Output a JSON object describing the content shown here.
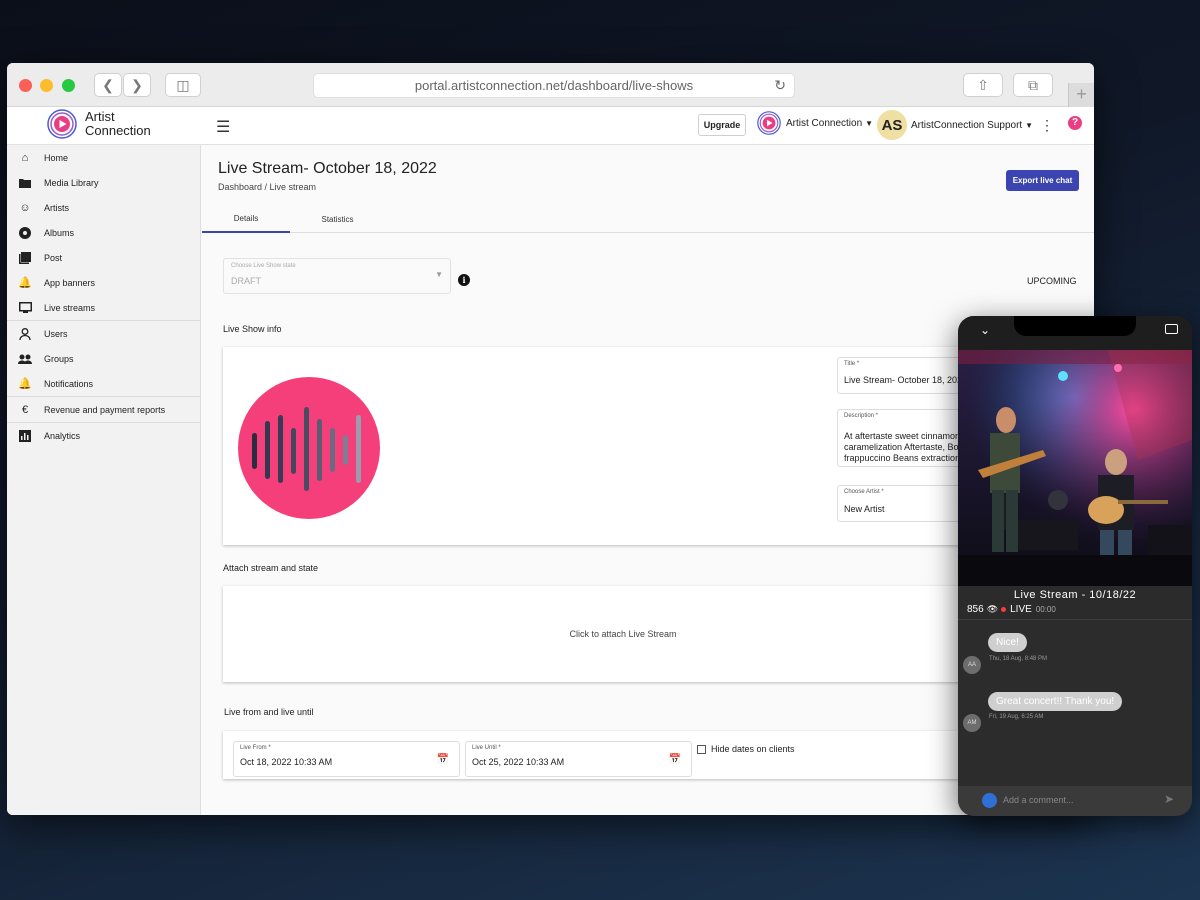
{
  "browser": {
    "url": "portal.artistconnection.net/dashboard/live-shows",
    "plus_label": "+"
  },
  "header": {
    "logo_line1": "Artist",
    "logo_line2": "Connection",
    "upgrade_label": "Upgrade",
    "org_name": "Artist Connection",
    "user_initials": "AS",
    "user_name": "ArtistConnection Support",
    "help_label": "?"
  },
  "sidebar": {
    "items": [
      {
        "label": "Home",
        "icon": "home-icon"
      },
      {
        "label": "Media Library",
        "icon": "folder-icon"
      },
      {
        "label": "Artists",
        "icon": "face-icon"
      },
      {
        "label": "Albums",
        "icon": "album-icon"
      },
      {
        "label": "Post",
        "icon": "post-library-icon"
      },
      {
        "label": "App banners",
        "icon": "bell-icon"
      },
      {
        "label": "Live streams",
        "icon": "monitor-icon"
      },
      {
        "label": "Users",
        "icon": "person-icon"
      },
      {
        "label": "Groups",
        "icon": "group-icon"
      },
      {
        "label": "Notifications",
        "icon": "bell-icon"
      },
      {
        "label": "Revenue and payment reports",
        "icon": "euro-icon"
      },
      {
        "label": "Analytics",
        "icon": "chart-icon"
      }
    ]
  },
  "main": {
    "title": "Live Stream- October 18, 2022",
    "breadcrumb": "Dashboard / Live stream",
    "export_label": "Export live chat",
    "tabs": [
      {
        "label": "Details",
        "active": true
      },
      {
        "label": "Statistics",
        "active": false
      }
    ],
    "state_select": {
      "label": "Choose Live Show state",
      "value": "DRAFT"
    },
    "state_status": "UPCOMING",
    "live_show_info_label": "Live Show info",
    "title_field": {
      "label": "Title *",
      "value": "Live Stream- October 18, 2022"
    },
    "description_field": {
      "label": "Description *",
      "lines": [
        "At aftertaste sweet cinnamon",
        "caramelization Aftertaste, Body",
        "frappuccino Beans extraction"
      ]
    },
    "artist_field": {
      "label": "Choose Artist *",
      "value": "New Artist"
    },
    "attach_label": "Attach stream and state",
    "attach_text": "Click to attach Live Stream",
    "live_range_label": "Live from and live until",
    "live_from": {
      "label": "Live From *",
      "value": "Oct 18, 2022 10:33 AM"
    },
    "live_until": {
      "label": "Live Until *",
      "value": "Oct 25, 2022 10:33 AM"
    },
    "hide_dates_label": "Hide dates on clients"
  },
  "phone": {
    "stream_title": "Live Stream - 10/18/22",
    "viewer_count": "856",
    "live_label": "LIVE",
    "live_time": "00:00",
    "messages": [
      {
        "initials": "AA",
        "text": "Nice!",
        "time": "Thu, 18 Aug, 8:48 PM"
      },
      {
        "initials": "AM",
        "text": "Great concert!! Thank you!",
        "time": "Fri, 19 Aug, 6:25 AM"
      }
    ],
    "comment_placeholder": "Add a comment..."
  },
  "colors": {
    "accent": "#3c44b1",
    "brand_pink": "#e93d84",
    "live_red": "#ff3b3b"
  }
}
